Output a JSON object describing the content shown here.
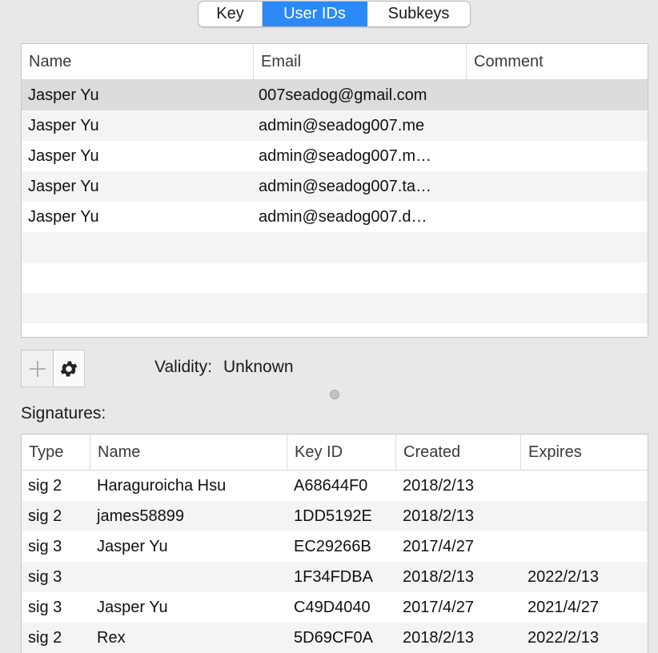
{
  "tabs": [
    {
      "label": "Key",
      "active": false
    },
    {
      "label": "User IDs",
      "active": true
    },
    {
      "label": "Subkeys",
      "active": false
    }
  ],
  "user_ids": {
    "columns": [
      "Name",
      "Email",
      "Comment"
    ],
    "rows": [
      {
        "name": "Jasper Yu",
        "email": "007seadog@gmail.com",
        "comment": "",
        "selected": true
      },
      {
        "name": "Jasper Yu",
        "email": "admin@seadog007.me",
        "comment": ""
      },
      {
        "name": "Jasper Yu",
        "email": "admin@seadog007.m…",
        "comment": ""
      },
      {
        "name": "Jasper Yu",
        "email": "admin@seadog007.ta…",
        "comment": ""
      },
      {
        "name": "Jasper Yu",
        "email": "admin@seadog007.d…",
        "comment": ""
      }
    ]
  },
  "toolbar": {
    "add_icon": "plus-icon",
    "settings_icon": "gear-icon"
  },
  "validity": {
    "label": "Validity:",
    "value": "Unknown"
  },
  "signatures": {
    "label": "Signatures:",
    "columns": [
      "Type",
      "Name",
      "Key ID",
      "Created",
      "Expires"
    ],
    "rows": [
      {
        "type": "sig 2",
        "name": "Haraguroicha Hsu",
        "key_id": "A68644F0",
        "created": "2018/2/13",
        "expires": ""
      },
      {
        "type": "sig 2",
        "name": "james58899",
        "key_id": "1DD5192E",
        "created": "2018/2/13",
        "expires": ""
      },
      {
        "type": "sig 3",
        "name": "Jasper Yu",
        "key_id": "EC29266B",
        "created": "2017/4/27",
        "expires": ""
      },
      {
        "type": "sig 3",
        "name": "",
        "key_id": "1F34FDBA",
        "created": "2018/2/13",
        "expires": "2022/2/13"
      },
      {
        "type": "sig 3",
        "name": "Jasper Yu",
        "key_id": "C49D4040",
        "created": "2017/4/27",
        "expires": "2021/4/27"
      },
      {
        "type": "sig 2",
        "name": "Rex",
        "key_id": "5D69CF0A",
        "created": "2018/2/13",
        "expires": "2022/2/13"
      }
    ]
  },
  "colors": {
    "accent": "#2b8af7",
    "selected_row": "#dcdcdc",
    "alt_row": "#f4f4f4"
  }
}
